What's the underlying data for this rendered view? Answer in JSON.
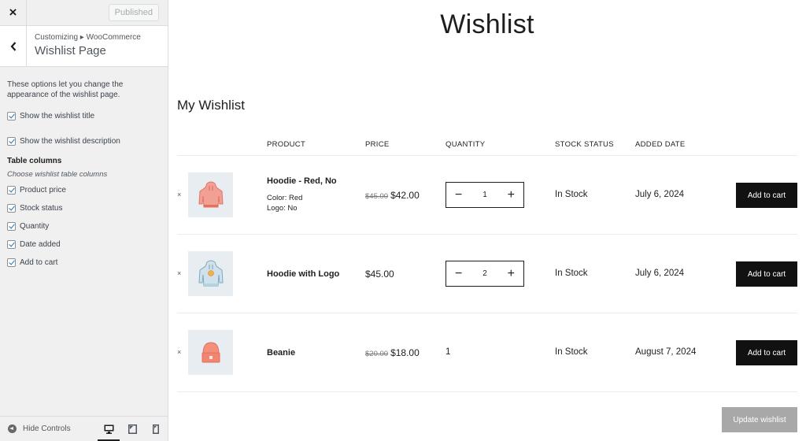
{
  "sidebar": {
    "close_label": "×",
    "publish_label": "Published",
    "back_label": "‹",
    "breadcrumb": "Customizing ▸ WooCommerce",
    "title": "Wishlist Page",
    "description": "These options let you change the appearance of the wishlist page.",
    "options": [
      {
        "label": "Show the wishlist title",
        "checked": true
      },
      {
        "label": "Show the wishlist description",
        "checked": true
      }
    ],
    "columns_section": {
      "title": "Table columns",
      "description": "Choose wishlist table columns",
      "items": [
        {
          "label": "Product price",
          "checked": true
        },
        {
          "label": "Stock status",
          "checked": true
        },
        {
          "label": "Quantity",
          "checked": true
        },
        {
          "label": "Date added",
          "checked": true
        },
        {
          "label": "Add to cart",
          "checked": true
        }
      ]
    },
    "footer": {
      "hide_controls_label": "Hide Controls",
      "devices": [
        "desktop",
        "tablet",
        "mobile"
      ],
      "active_device": "desktop"
    }
  },
  "main": {
    "page_title": "Wishlist",
    "wishlist_name": "My Wishlist",
    "columns": [
      "PRODUCT",
      "PRICE",
      "QUANTITY",
      "STOCK STATUS",
      "ADDED DATE"
    ],
    "rows": [
      {
        "remove": "×",
        "image": "red-hoodie",
        "name": "Hoodie - Red, No",
        "meta": [
          "Color: Red",
          "Logo:  No"
        ],
        "old_price": "$45.00",
        "price": "$42.00",
        "quantity": "1",
        "quantity_editable": true,
        "stock": "In Stock",
        "date": "July 6, 2024",
        "action": "Add to cart"
      },
      {
        "remove": "×",
        "image": "blue-hoodie-logo",
        "name": "Hoodie with Logo",
        "meta": [],
        "old_price": "",
        "price": "$45.00",
        "quantity": "2",
        "quantity_editable": true,
        "stock": "In Stock",
        "date": "July 6, 2024",
        "action": "Add to cart"
      },
      {
        "remove": "×",
        "image": "beanie",
        "name": "Beanie",
        "meta": [],
        "old_price": "$20.00",
        "price": "$18.00",
        "quantity": "1",
        "quantity_editable": false,
        "stock": "In Stock",
        "date": "August 7, 2024",
        "action": "Add to cart"
      }
    ],
    "qty_minus": "−",
    "qty_plus": "+",
    "update_label": "Update wishlist"
  }
}
